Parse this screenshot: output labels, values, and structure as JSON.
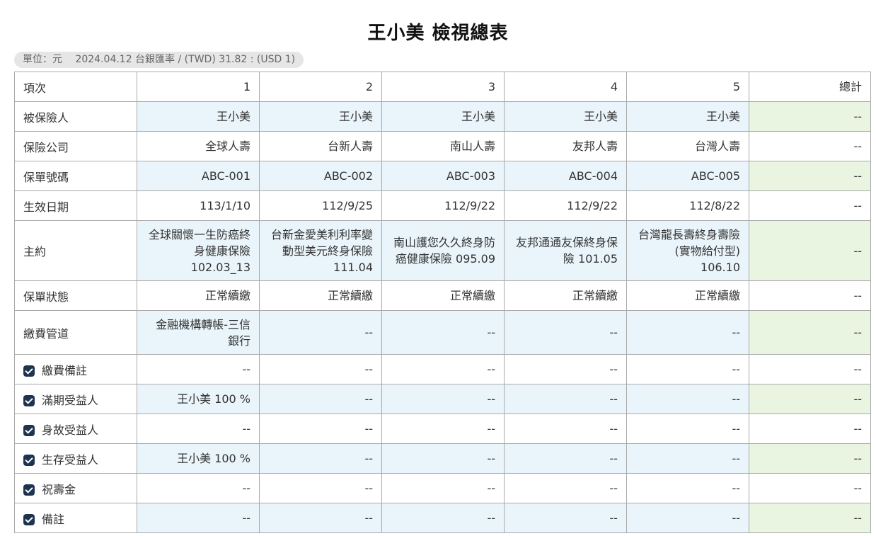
{
  "title": "王小美 檢視總表",
  "unit_bar": {
    "unit": "單位：元",
    "rate": "2024.04.12 台銀匯率 / (TWD) 31.82 : (USD 1)"
  },
  "header": {
    "label": "項次",
    "columns": [
      "1",
      "2",
      "3",
      "4",
      "5"
    ],
    "total": "總計"
  },
  "rows": [
    {
      "label": "被保險人",
      "values": [
        "王小美",
        "王小美",
        "王小美",
        "王小美",
        "王小美"
      ],
      "total": "--"
    },
    {
      "label": "保險公司",
      "values": [
        "全球人壽",
        "台新人壽",
        "南山人壽",
        "友邦人壽",
        "台灣人壽"
      ],
      "total": "--"
    },
    {
      "label": "保單號碼",
      "values": [
        "ABC-001",
        "ABC-002",
        "ABC-003",
        "ABC-004",
        "ABC-005"
      ],
      "total": "--"
    },
    {
      "label": "生效日期",
      "values": [
        "113/1/10",
        "112/9/25",
        "112/9/22",
        "112/9/22",
        "112/8/22"
      ],
      "total": "--"
    },
    {
      "label": "主約",
      "values": [
        "全球關懷一生防癌終身健康保險 102.03_13",
        "台新金愛美利利率變動型美元終身保險 111.04",
        "南山護您久久終身防癌健康保險 095.09",
        "友邦通通友保終身保險 101.05",
        "台灣龍長壽終身壽險(實物給付型) 106.10"
      ],
      "total": "--"
    },
    {
      "label": "保單狀態",
      "values": [
        "正常續繳",
        "正常續繳",
        "正常續繳",
        "正常續繳",
        "正常續繳"
      ],
      "total": "--"
    },
    {
      "label": "繳費管道",
      "values": [
        "金融機構轉帳-三信銀行",
        "--",
        "--",
        "--",
        "--"
      ],
      "total": "--"
    },
    {
      "label": "繳費備註",
      "checkbox": true,
      "values": [
        "--",
        "--",
        "--",
        "--",
        "--"
      ],
      "total": "--"
    },
    {
      "label": "滿期受益人",
      "checkbox": true,
      "values": [
        "王小美 100 %",
        "--",
        "--",
        "--",
        "--"
      ],
      "total": "--"
    },
    {
      "label": "身故受益人",
      "checkbox": true,
      "values": [
        "--",
        "--",
        "--",
        "--",
        "--"
      ],
      "total": "--"
    },
    {
      "label": "生存受益人",
      "checkbox": true,
      "values": [
        "王小美 100 %",
        "--",
        "--",
        "--",
        "--"
      ],
      "total": "--"
    },
    {
      "label": "祝壽金",
      "checkbox": true,
      "values": [
        "--",
        "--",
        "--",
        "--",
        "--"
      ],
      "total": "--"
    },
    {
      "label": "備註",
      "checkbox": true,
      "values": [
        "--",
        "--",
        "--",
        "--",
        "--"
      ],
      "total": "--"
    }
  ],
  "colors": {
    "row_tint_blue": "#eaf5fb",
    "row_tint_green": "#eaf5e1",
    "checkbox": "#1d3350",
    "border": "#a9a9a9"
  }
}
